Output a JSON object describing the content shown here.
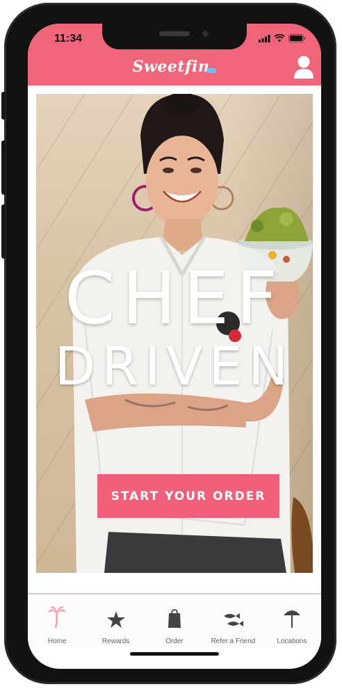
{
  "status_bar": {
    "time": "11:34",
    "icons": [
      "signal-icon",
      "wifi-icon",
      "battery-icon"
    ]
  },
  "header": {
    "brand": "Sweetfin",
    "profile_icon": "user-icon",
    "background_color": "#f1657b"
  },
  "hero": {
    "headline_line1": "CHEF",
    "headline_line2": "DRIVEN",
    "cta_label": "START YOUR ORDER",
    "cta_color": "#f0607a",
    "carousel": {
      "slides": 2,
      "active_index": 1
    }
  },
  "tabbar": {
    "items": [
      {
        "label": "Home",
        "icon": "palm-tree-icon",
        "active": true
      },
      {
        "label": "Rewards",
        "icon": "starfish-icon",
        "active": false
      },
      {
        "label": "Order",
        "icon": "bag-icon",
        "active": false
      },
      {
        "label": "Refer a Friend",
        "icon": "fish-icon",
        "active": false
      },
      {
        "label": "Locations",
        "icon": "umbrella-icon",
        "active": false
      }
    ],
    "active_color": "#f4a1ae",
    "inactive_color": "#444444"
  }
}
